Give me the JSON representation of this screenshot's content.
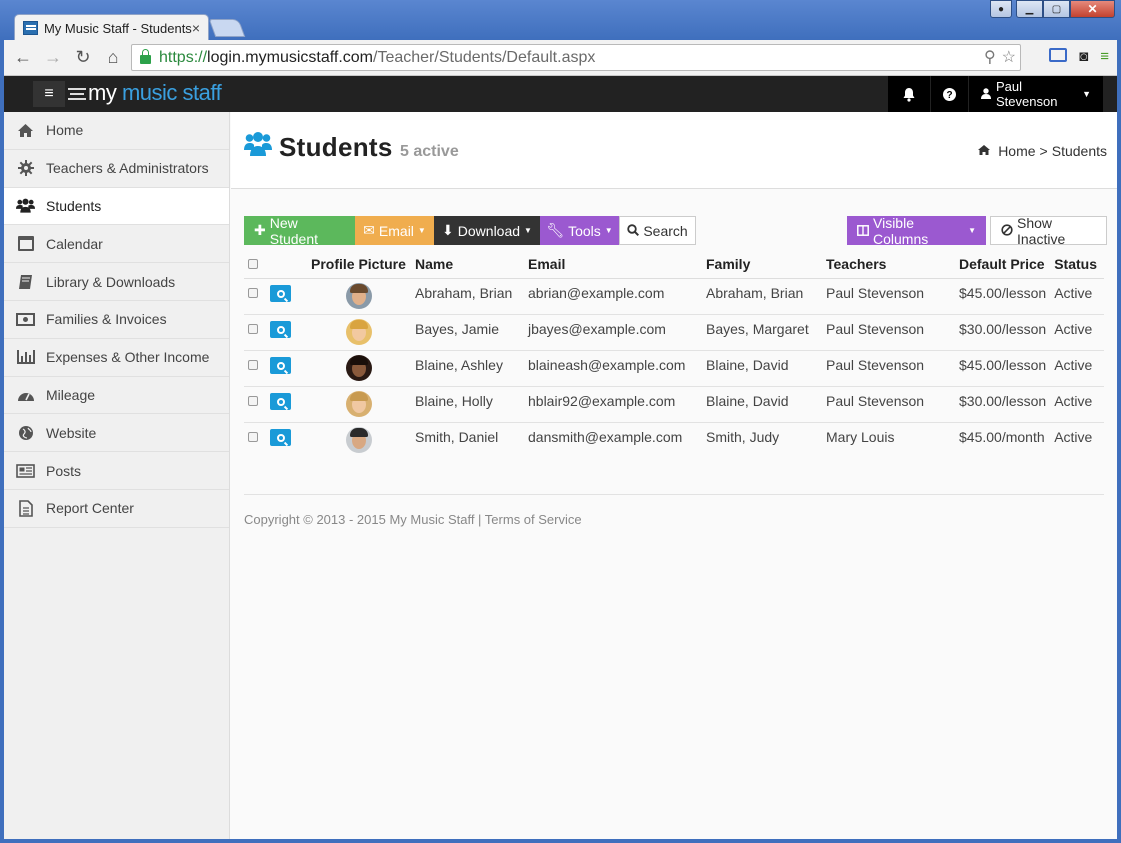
{
  "browser": {
    "tab_title": "My Music Staff - Students",
    "tab_close": "×",
    "url_scheme": "https://",
    "url_host": "login.mymusicstaff.com",
    "url_path": "/Teacher/Students/Default.aspx"
  },
  "topnav": {
    "logo_my": "my",
    "logo_rest": " music staff",
    "user_name": "Paul Stevenson"
  },
  "sidebar": {
    "items": [
      {
        "label": "Home",
        "icon": "home-icon"
      },
      {
        "label": "Teachers & Administrators",
        "icon": "gear-icon"
      },
      {
        "label": "Students",
        "icon": "users-icon",
        "active": true
      },
      {
        "label": "Calendar",
        "icon": "calendar-icon"
      },
      {
        "label": "Library & Downloads",
        "icon": "book-icon"
      },
      {
        "label": "Families & Invoices",
        "icon": "money-icon"
      },
      {
        "label": "Expenses & Other Income",
        "icon": "bar-chart-icon"
      },
      {
        "label": "Mileage",
        "icon": "dashboard-icon"
      },
      {
        "label": "Website",
        "icon": "globe-icon"
      },
      {
        "label": "Posts",
        "icon": "newspaper-icon"
      },
      {
        "label": "Report Center",
        "icon": "document-icon"
      }
    ]
  },
  "header": {
    "title": "Students",
    "active_count": "5 active",
    "breadcrumb_home": "Home",
    "breadcrumb_sep": ">",
    "breadcrumb_current": "Students"
  },
  "toolbar": {
    "new_student": "New Student",
    "email": "Email",
    "download": "Download",
    "tools": "Tools",
    "search": "Search",
    "visible_columns": "Visible Columns",
    "show_inactive": "Show Inactive"
  },
  "table": {
    "columns": [
      "Profile Picture",
      "Name",
      "Email",
      "Family",
      "Teachers",
      "Default Price",
      "Status"
    ],
    "rows": [
      {
        "name": "Abraham, Brian",
        "email": "abrian@example.com",
        "family": "Abraham, Brian",
        "teacher": "Paul Stevenson",
        "price": "$45.00/lesson",
        "status": "Active"
      },
      {
        "name": "Bayes, Jamie",
        "email": "jbayes@example.com",
        "family": "Bayes, Margaret",
        "teacher": "Paul Stevenson",
        "price": "$30.00/lesson",
        "status": "Active"
      },
      {
        "name": "Blaine, Ashley",
        "email": "blaineash@example.com",
        "family": "Blaine, David",
        "teacher": "Paul Stevenson",
        "price": "$45.00/lesson",
        "status": "Active"
      },
      {
        "name": "Blaine, Holly",
        "email": "hblair92@example.com",
        "family": "Blaine, David",
        "teacher": "Paul Stevenson",
        "price": "$30.00/lesson",
        "status": "Active"
      },
      {
        "name": "Smith, Daniel",
        "email": "dansmith@example.com",
        "family": "Smith, Judy",
        "teacher": "Mary Louis",
        "price": "$45.00/month",
        "status": "Active"
      }
    ]
  },
  "footer": {
    "copyright": "Copyright © 2013 - 2015 My Music Staff | Terms of Service"
  },
  "colors": {
    "accent_blue": "#1a9ad8",
    "green": "#5cb85c",
    "yellow": "#f0ad4e",
    "purple": "#9b59d0",
    "navbar": "#222222"
  }
}
